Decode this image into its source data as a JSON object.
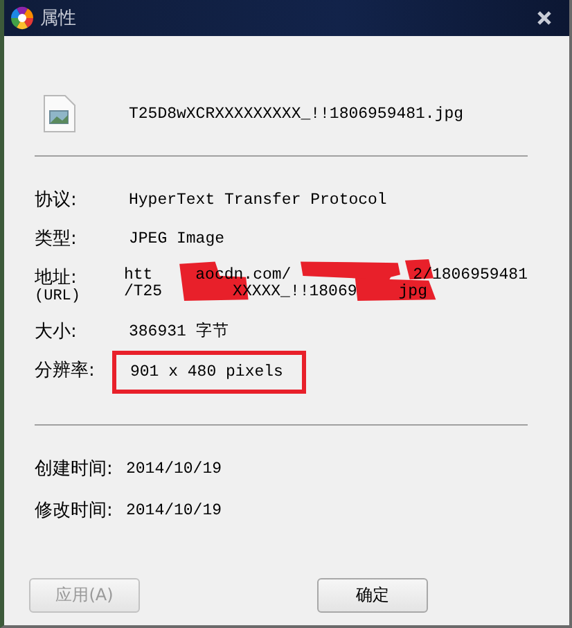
{
  "window": {
    "title": "属性"
  },
  "file": {
    "name": "T25D8wXCRXXXXXXXXX_!!1806959481.jpg"
  },
  "details": [
    {
      "kind": "text",
      "label": "协议:",
      "value": "HyperText Transfer Protocol"
    },
    {
      "kind": "text",
      "label": "类型:",
      "value": "JPEG Image"
    },
    {
      "kind": "url",
      "label": "地址:",
      "sublabel": "(URL)",
      "lines": [
        [
          "htt",
          "aocdn.com/",
          "2/1806959481"
        ],
        [
          "/T25",
          "XXXXX_!!18069",
          "jpg"
        ]
      ],
      "redacted": true
    },
    {
      "kind": "text",
      "label": "大小:",
      "value": "386931 字节"
    },
    {
      "kind": "text",
      "label": "分辨率:",
      "value": "901 x 480 pixels",
      "highlighted": true
    }
  ],
  "dates": [
    {
      "label": "创建时间:",
      "value": "2014/10/19"
    },
    {
      "label": "修改时间:",
      "value": "2014/10/19"
    }
  ],
  "buttons": [
    {
      "label": "应用(A)",
      "disabled": true
    },
    {
      "label": "确定",
      "disabled": false
    }
  ]
}
